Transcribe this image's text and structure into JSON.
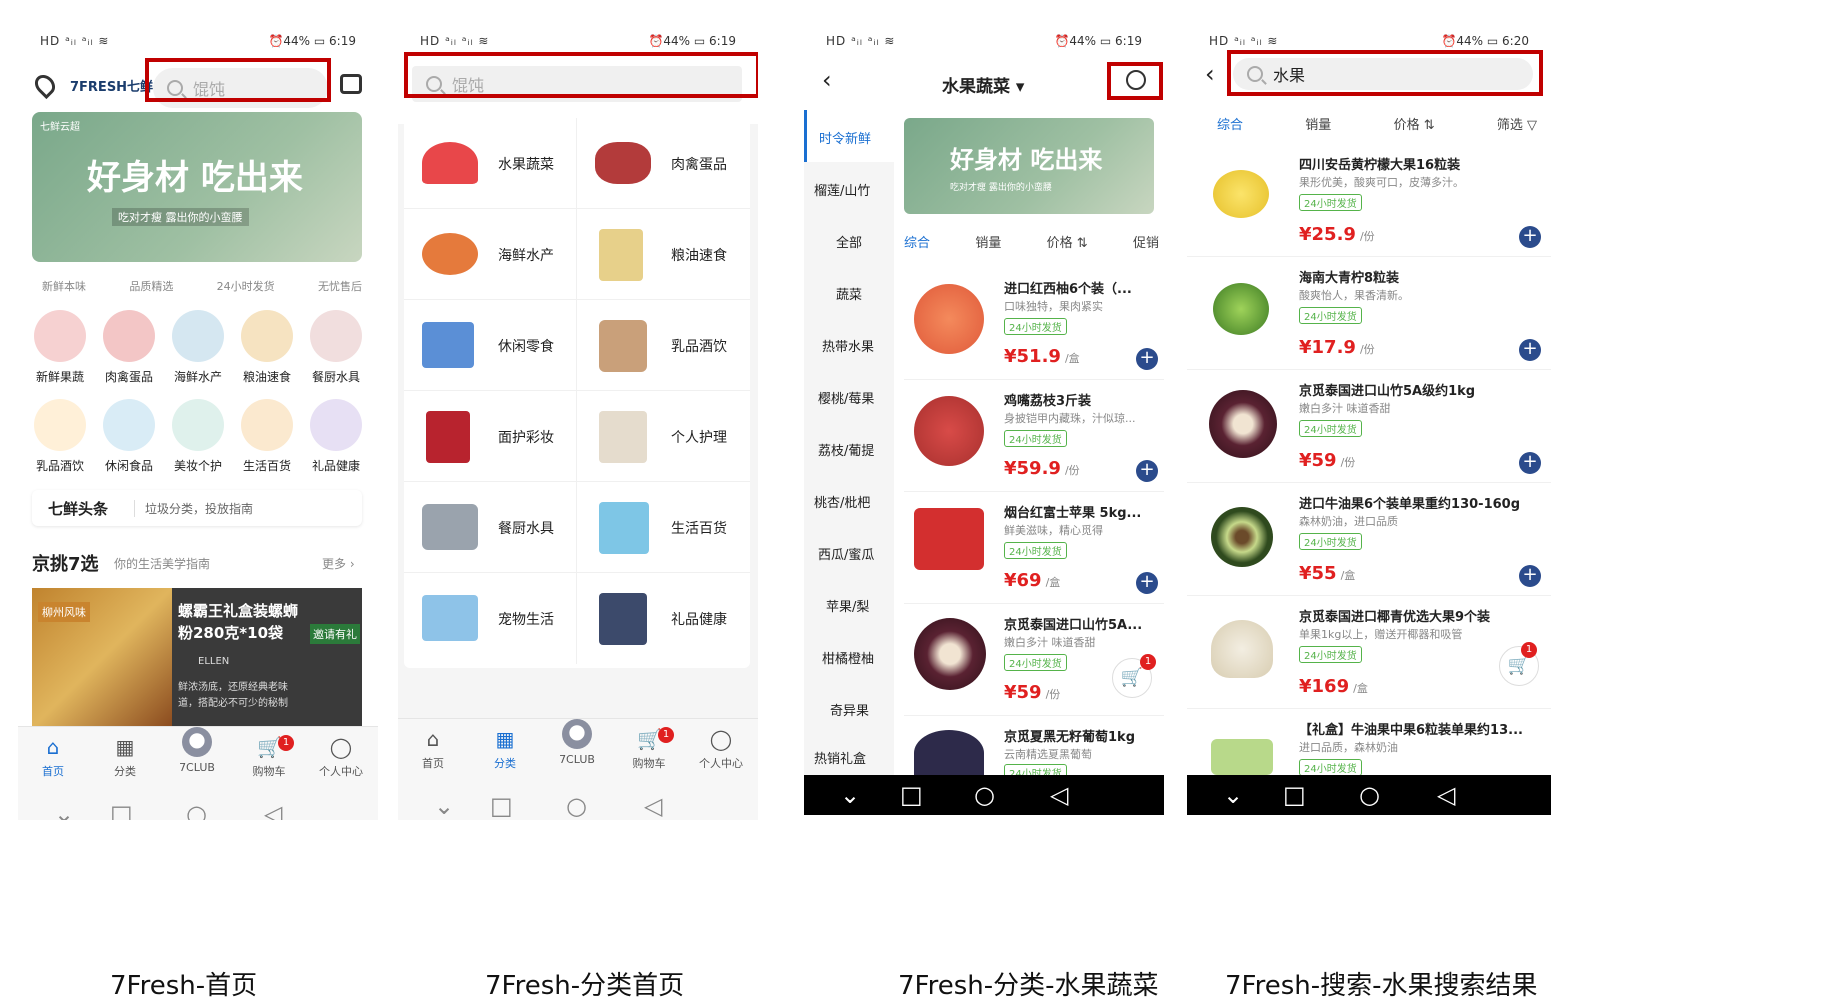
{
  "status": {
    "left": "HD ᵃᵢₗ ᵃᵢₗ ≋",
    "right_1": "⏰44% ▭ 6:19",
    "right_2": "⏰44% ▭ 6:19",
    "right_3": "⏰44% ▭ 6:19",
    "right_4": "⏰44% ▭ 6:20"
  },
  "captions": {
    "s1": "7Fresh-首页",
    "s2": "7Fresh-分类首页",
    "s3": "7Fresh-分类-水果蔬菜",
    "s4": "7Fresh-搜索-水果搜索结果"
  },
  "home": {
    "logo": "7FRESH七鲜",
    "search_placeholder": "馄饨",
    "banner_tag": "七鲜云超",
    "banner_title": "好身材 吃出来",
    "banner_sub": "吃对才瘦 露出你的小蛮腰",
    "features": [
      "新鲜本味",
      "品质精选",
      "24小时发货",
      "无忧售后"
    ],
    "categories": [
      "新鲜果蔬",
      "肉禽蛋品",
      "海鲜水产",
      "粮油速食",
      "餐厨水具",
      "乳品酒饮",
      "休闲食品",
      "美妆个护",
      "生活百货",
      "礼品健康"
    ],
    "headline_title": "七鲜头条",
    "headline_text": "垃圾分类，投放指南",
    "section_title": "京挑7选",
    "section_sub": "你的生活美学指南",
    "section_more": "更多 ›",
    "promo_tag": "柳州风味",
    "promo_title": "螺霸王礼盒装螺蛳粉280克*10袋",
    "promo_author": "ELLEN",
    "promo_desc": "鲜浓汤底，还原经典老味道，搭配必不可少的秘制",
    "promo_corner": "邀请有礼"
  },
  "nav": {
    "home": "首页",
    "category": "分类",
    "club": "7CLUB",
    "cart": "购物车",
    "me": "个人中心",
    "cart_badge": "1"
  },
  "category": {
    "search_placeholder": "馄饨",
    "items": [
      "水果蔬菜",
      "肉禽蛋品",
      "海鲜水产",
      "粮油速食",
      "休闲零食",
      "乳品酒饮",
      "面护彩妆",
      "个人护理",
      "餐厨水具",
      "生活百货",
      "宠物生活",
      "礼品健康"
    ]
  },
  "fruit": {
    "title": "水果蔬菜 ▾",
    "sidebar": [
      "时令新鲜",
      "榴莲/山竹",
      "全部",
      "蔬菜",
      "热带水果",
      "樱桃/莓果",
      "荔枝/葡提",
      "桃杏/枇杷",
      "西瓜/蜜瓜",
      "苹果/梨",
      "柑橘橙柚",
      "奇异果",
      "热销礼盒"
    ],
    "banner_title": "好身材 吃出来",
    "banner_sub": "吃对才瘦 露出你的小蛮腰",
    "sorts": [
      "综合",
      "销量",
      "价格 ⇅",
      "促销"
    ],
    "tag": "24小时发货",
    "products": [
      {
        "name": "进口红西柚6个装（...",
        "desc": "口味独特，果肉紧实",
        "price": "¥51.9",
        "unit": "/盒"
      },
      {
        "name": "鸡嘴荔枝3斤装",
        "desc": "身披铠甲内藏珠，汁似琼...",
        "price": "¥59.9",
        "unit": "/份"
      },
      {
        "name": "烟台红富士苹果 5kg...",
        "desc": "鲜美滋味，精心觅得",
        "price": "¥69",
        "unit": "/盒"
      },
      {
        "name": "京觅泰国进口山竹5A...",
        "desc": "嫩白多汁 味道香甜",
        "price": "¥59",
        "unit": "/份"
      },
      {
        "name": "京觅夏黑无籽葡萄1kg",
        "desc": "云南精选夏黑葡萄",
        "price": "",
        "unit": ""
      }
    ]
  },
  "search": {
    "query": "水果",
    "sorts": [
      "综合",
      "销量",
      "价格 ⇅",
      "筛选 ▽"
    ],
    "tag": "24小时发货",
    "products": [
      {
        "name": "四川安岳黄柠檬大果16粒装",
        "desc": "果形优美，酸爽可口，皮薄多汁。",
        "price": "¥25.9",
        "unit": "/份"
      },
      {
        "name": "海南大青柠8粒装",
        "desc": "酸爽怡人，果香清新。",
        "price": "¥17.9",
        "unit": "/份"
      },
      {
        "name": "京觅泰国进口山竹5A级约1kg",
        "desc": "嫩白多汁 味道香甜",
        "price": "¥59",
        "unit": "/份"
      },
      {
        "name": "进口牛油果6个装单果重约130-160g",
        "desc": "森林奶油，进口品质",
        "price": "¥55",
        "unit": "/盒"
      },
      {
        "name": "京觅泰国进口椰青优选大果9个装",
        "desc": "单果1kg以上，赠送开椰器和吸管",
        "price": "¥169",
        "unit": "/盒"
      },
      {
        "name": "【礼盒】牛油果中果6粒装单果约13...",
        "desc": "进口品质，森林奶油",
        "price": "",
        "unit": ""
      }
    ]
  },
  "colors": {
    "accent": "#1a6fd1",
    "price": "#e02020",
    "highlight_box": "#c00000",
    "tag": "#55b34a"
  }
}
